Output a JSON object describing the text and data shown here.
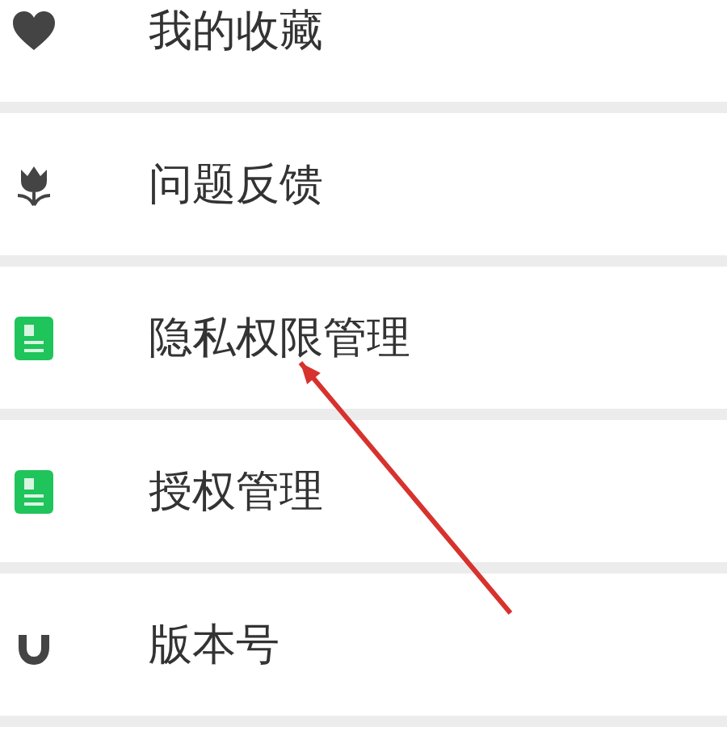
{
  "menu_items": [
    {
      "label": "我的收藏",
      "arrow_points_here": false
    },
    {
      "label": "问题反馈",
      "arrow_points_here": false
    },
    {
      "label": "隐私权限管理",
      "arrow_points_here": true
    },
    {
      "label": "授权管理",
      "arrow_points_here": false
    },
    {
      "label": "版本号",
      "arrow_points_here": false
    }
  ]
}
